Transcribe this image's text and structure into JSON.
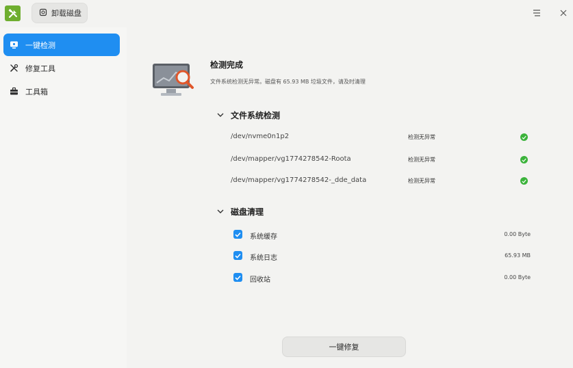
{
  "titlebar": {
    "tab_label": "卸载磁盘",
    "icons": {
      "app": "toolbox-logo",
      "tab": "disk-icon",
      "menu": "menu-icon",
      "close": "close-icon"
    }
  },
  "sidebar": {
    "items": [
      {
        "label": "一键检测",
        "icon": "monitor-icon",
        "active": true
      },
      {
        "label": "修复工具",
        "icon": "tools-icon",
        "active": false
      },
      {
        "label": "工具箱",
        "icon": "toolbox-icon",
        "active": false
      }
    ]
  },
  "status": {
    "title": "检测完成",
    "description": "文件系统检测无异常。磁盘有 65.93 MB 垃圾文件，请及时清理"
  },
  "filesystem": {
    "heading": "文件系统检测",
    "devices": [
      {
        "name": "/dev/nvme0n1p2",
        "status": "检测无异常"
      },
      {
        "name": "/dev/mapper/vg1774278542-Roota",
        "status": "检测无异常"
      },
      {
        "name": "/dev/mapper/vg1774278542-_dde_data",
        "status": "检测无异常"
      }
    ]
  },
  "cleanup": {
    "heading": "磁盘清理",
    "items": [
      {
        "label": "系统缓存",
        "size": "0.00 Byte",
        "checked": true
      },
      {
        "label": "系统日志",
        "size": "65.93 MB",
        "checked": true
      },
      {
        "label": "回收站",
        "size": "0.00 Byte",
        "checked": true
      }
    ]
  },
  "actions": {
    "repair_label": "一键修复"
  },
  "colors": {
    "accent": "#1f8ef1",
    "ok": "#3bb33b",
    "logo": "#6fae2f"
  }
}
